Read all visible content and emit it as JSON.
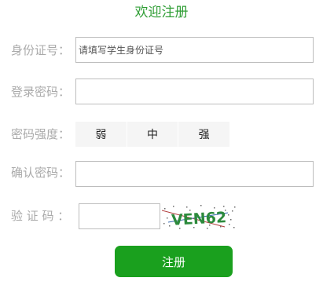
{
  "title": "欢迎注册",
  "fields": {
    "id_number": {
      "label": "身份证号：",
      "placeholder": "请填写学生身份证号",
      "value": ""
    },
    "password": {
      "label": "登录密码：",
      "value": ""
    },
    "strength": {
      "label": "密码强度：",
      "levels": [
        "弱",
        "中",
        "强"
      ]
    },
    "confirm_password": {
      "label": "确认密码：",
      "value": ""
    },
    "captcha": {
      "label": "验 证 码 ：",
      "value": "",
      "image_text": "VEN62"
    }
  },
  "submit_label": "注册",
  "colors": {
    "title": "#2f9e35",
    "label": "#aaaaaa",
    "button": "#1aa01e",
    "captcha_text": "#2c8a3c"
  },
  "icons": {
    "captcha_image": "captcha-image"
  }
}
